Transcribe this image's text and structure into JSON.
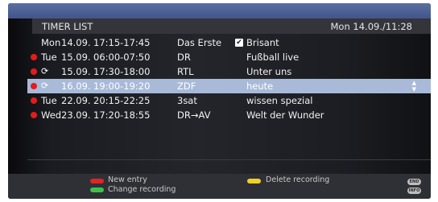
{
  "header": {
    "title": "TIMER LIST",
    "clock": "Mon 14.09./11:28"
  },
  "rows": [
    {
      "status": "none",
      "icon": "",
      "day": "Mon",
      "date": "14.09.",
      "time": "17:15-17:45",
      "channel": "Das Erste",
      "checked": true,
      "program": "Brisant",
      "selected": false
    },
    {
      "status": "record",
      "icon": "record-icon",
      "day": "Tue",
      "date": "15.09.",
      "time": "06:00-07:50",
      "channel": "DR",
      "checked": false,
      "program": "Fußball live",
      "selected": false
    },
    {
      "status": "record",
      "icon": "repeat-icon",
      "day": "",
      "date": "15.09.",
      "time": "17:30-18:00",
      "channel": "RTL",
      "checked": false,
      "program": "Unter uns",
      "selected": false
    },
    {
      "status": "record",
      "icon": "repeat-icon",
      "day": "",
      "date": "16.09.",
      "time": "19:00-19:20",
      "channel": "ZDF",
      "checked": false,
      "program": "heute",
      "selected": true
    },
    {
      "status": "record",
      "icon": "",
      "day": "Tue",
      "date": "22.09.",
      "time": "20:15-22:25",
      "channel": "3sat",
      "checked": false,
      "program": "wissen spezial",
      "selected": false
    },
    {
      "status": "record",
      "icon": "",
      "day": "Wed",
      "date": "23.09.",
      "time": "17:20-18:55",
      "channel": "DR→AV",
      "checked": false,
      "program": "Welt der Wunder",
      "selected": false
    }
  ],
  "footer": {
    "red_label": "New entry",
    "green_label": "Change recording",
    "yellow_label": "Delete recording",
    "end_label": "END",
    "info_label": "INFO"
  },
  "colors": {
    "selected_row": "#a8bad8",
    "record_dot": "#e31c1c",
    "red_key": "#e22424",
    "green_key": "#3cc24a",
    "yellow_key": "#f2d21e"
  }
}
